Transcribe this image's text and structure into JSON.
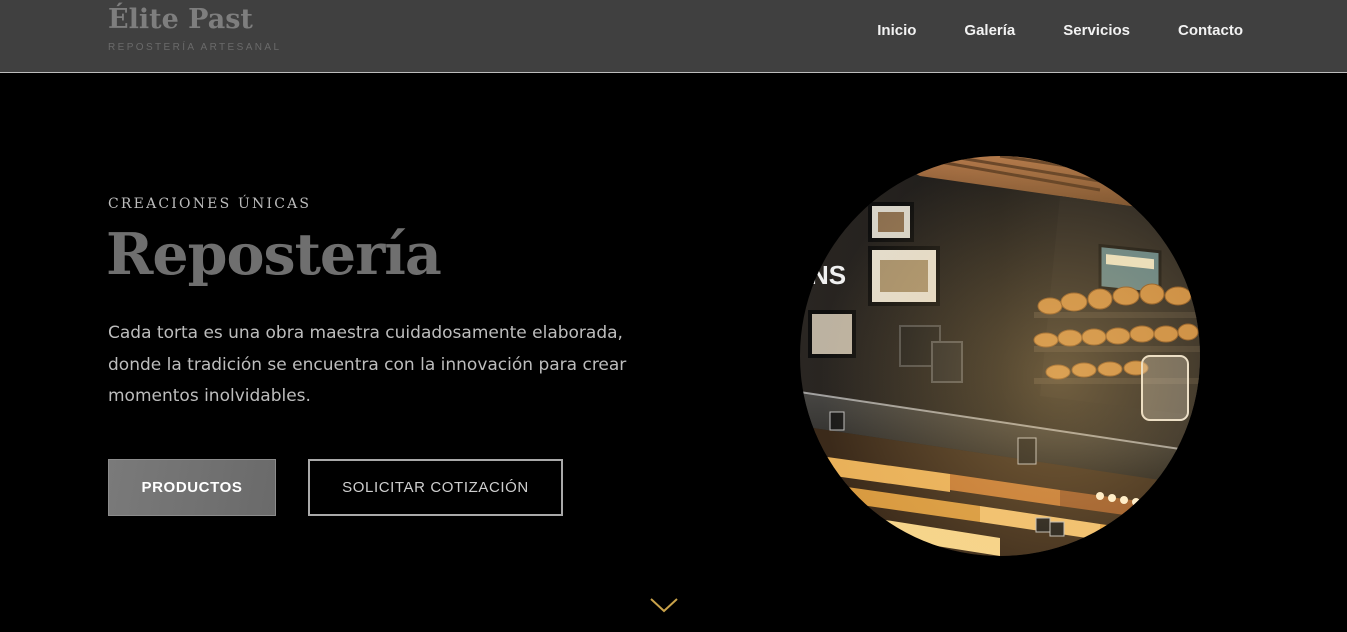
{
  "brand": {
    "title": "Élite Past",
    "subtitle": "REPOSTERÍA ARTESANAL"
  },
  "nav": {
    "items": [
      {
        "label": "Inicio"
      },
      {
        "label": "Galería"
      },
      {
        "label": "Servicios"
      },
      {
        "label": "Contacto"
      }
    ]
  },
  "hero": {
    "eyebrow": "CREACIONES ÚNICAS",
    "title": "Repostería",
    "description": "Cada torta es una obra maestra cuidadosamente elaborada, donde la tradición se encuentra con la innovación para crear momentos inolvidables.",
    "primary_button": "PRODUCTOS",
    "secondary_button": "SOLICITAR COTIZACIÓN"
  },
  "icons": {
    "scroll": "chevron-down-icon"
  },
  "colors": {
    "header_bg": "#404040",
    "page_bg": "#000000",
    "accent_gold": "#c9a24a",
    "button_primary_bg": "#757575"
  }
}
